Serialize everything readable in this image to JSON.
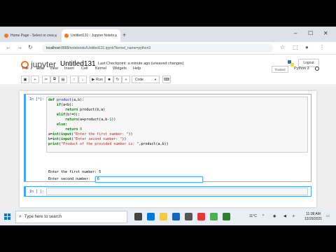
{
  "browser": {
    "tabs": [
      {
        "label": "Home Page - Select or create a",
        "active": false
      },
      {
        "label": "Untitled131 - Jupyter Notebook",
        "active": true
      }
    ],
    "new_tab": "+",
    "url_host": "localhost",
    "url_path": ":8888/notebooks/Untitled131.ipynb?kernel_name=python3",
    "win_min": "–",
    "win_max": "☐",
    "win_close": "✕",
    "back": "←",
    "forward": "→",
    "reload": "↻"
  },
  "jupyter": {
    "logo_text": "jupyter",
    "notebook_title": "Untitled131",
    "checkpoint": "Last Checkpoint: a minute ago  (unsaved changes)",
    "logout": "Logout",
    "menu": [
      "File",
      "Edit",
      "View",
      "Insert",
      "Cell",
      "Kernel",
      "Widgets",
      "Help"
    ],
    "trusted": "Trusted",
    "kernel_name": "Python 3",
    "toolbar": {
      "run": "▶ Run",
      "cell_type": "Code"
    }
  },
  "cells": [
    {
      "prompt": "In [*]:",
      "code": [
        "def product(a,b):",
        "    if(a<b):",
        "        return product(b,a)",
        "    elif(b!=0):",
        "        return(a+product(a,b-1))",
        "    else:",
        "        return 0",
        "a=int(input(\"Enter the first number: \"))",
        "b=int(input(\"Enter second number: \"))",
        "print(\"Product of the provided number is: \",product(a,b))"
      ],
      "output": [
        "Enter the first number: 5",
        "Enter second number: "
      ],
      "stdin_value": "6"
    },
    {
      "prompt": "In [ ]:",
      "code": [
        ""
      ]
    }
  ],
  "taskbar": {
    "search_placeholder": "Type here to search",
    "weather": "11°C",
    "time": "11:38 AM",
    "date": "12/29/2021"
  }
}
